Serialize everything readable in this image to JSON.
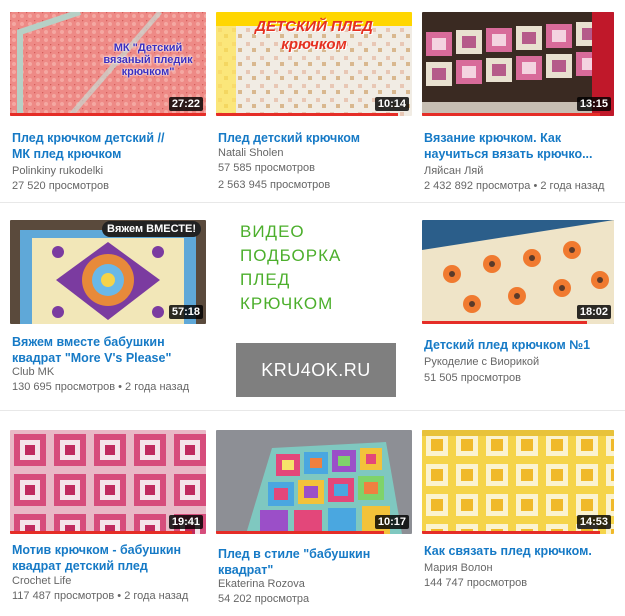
{
  "promo": {
    "lines": [
      "ВИДЕО",
      "ПОДБОРКА",
      "ПЛЕД",
      "КРЮЧКОМ"
    ],
    "site": "KRU4OK.RU",
    "text_color": "#4caf2c",
    "box_color": "#7f7f7f"
  },
  "videos": [
    {
      "title1": "Плед крючком детский //",
      "title2": "МК плед крючком",
      "channel": "Polinkiny rukodelki",
      "views": "27 520 просмотров",
      "age": "",
      "duration": "27:22",
      "progress": 1.0,
      "overlay": "МК \"Детский вязаный пледик крючком\""
    },
    {
      "title1": "Плед детский крючком",
      "title2": "",
      "channel": "Natali Sholen",
      "views": "57 585 просмотров",
      "age": "",
      "views2": "2 563 945 просмотров",
      "duration": "10:14",
      "progress": 0.93,
      "overlay": "ДЕТСКИЙ ПЛЕД крючком"
    },
    {
      "title1": "Вязание крючком. Как",
      "title2": "научиться вязать крючко...",
      "channel": "Ляйсан Ляй",
      "views": "2 432 892 просмотра",
      "age": "2 года назад",
      "duration": "13:15",
      "progress": 0.93,
      "overlay": ""
    },
    {
      "title1": "Вяжем вместе бабушкин",
      "title2": "квадрат \"More V's Please\"",
      "channel": "Club MK",
      "views": "130 695 просмотров",
      "age": "2 года назад",
      "duration": "57:18",
      "progress": 0.0,
      "overlay": "Вяжем ВМЕСТЕ!"
    },
    {
      "title1": "Детский плед крючком №1",
      "title2": "",
      "channel": "Рукоделие с Виорикой",
      "views": "51 505 просмотров",
      "age": "",
      "duration": "18:02",
      "progress": 0.86,
      "overlay": ""
    },
    {
      "title1": "Мотив крючком - бабушкин",
      "title2": "квадрат детский плед",
      "channel": "Crochet Life",
      "views": "117 487 просмотров",
      "age": "2 года назад",
      "duration": "19:41",
      "progress": 0.93,
      "overlay": ""
    },
    {
      "title1": "Плед в стиле \"бабушкин",
      "title2": "квадрат\"",
      "channel": "Ekaterina Rozova",
      "views": "54 202 просмотра",
      "age": "",
      "duration": "10:17",
      "progress": 0.86,
      "overlay": ""
    },
    {
      "title1": "Как связать плед крючком.",
      "title2": "",
      "channel": "Мария Волон",
      "views": "144 747 просмотров",
      "age": "",
      "duration": "14:53",
      "progress": 0.93,
      "overlay": ""
    }
  ]
}
